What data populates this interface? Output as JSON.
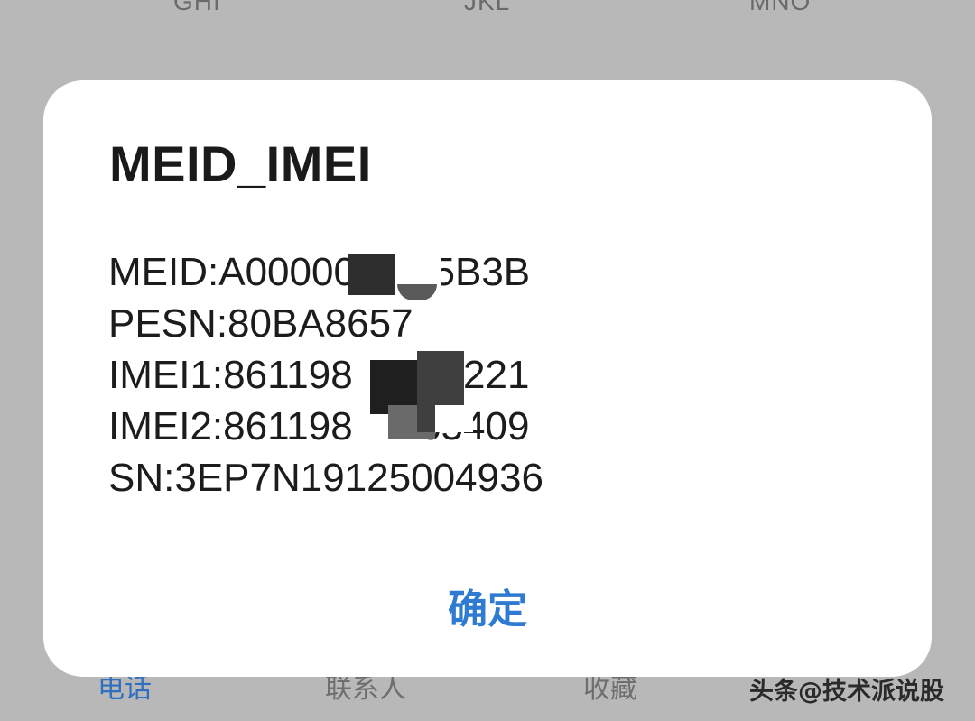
{
  "keypad": {
    "ghi": "GHI",
    "jkl": "JKL",
    "mno": "MNO"
  },
  "dialog": {
    "title": "MEID_IMEI",
    "lines": [
      "MEID:A00000     45B3B",
      "PESN:80BA8657",
      "IMEI1:861198    380221",
      "IMEI2:861198    765409",
      "SN:3EP7N19125004936"
    ],
    "confirm_label": "确定"
  },
  "bottom_nav": {
    "phone": "电话",
    "contacts": "联系人",
    "favorites": "收藏",
    "watermark": "头条@技术派说股"
  },
  "colors": {
    "accent": "#2f7bd1",
    "backdrop": "#b8b8b8",
    "dialog_bg": "#ffffff"
  }
}
